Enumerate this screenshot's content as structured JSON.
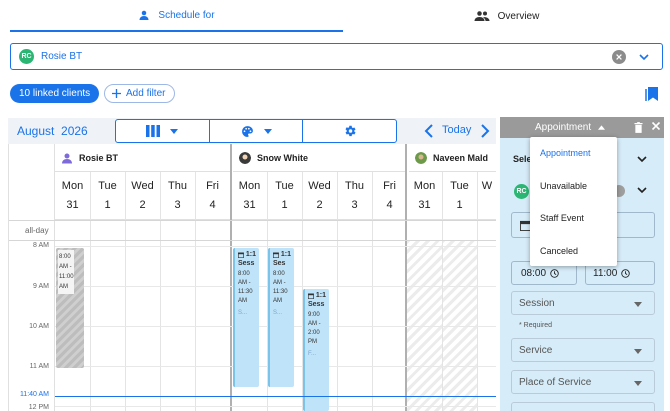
{
  "tabs": {
    "schedule_label": "Schedule for",
    "overview_label": "Overview"
  },
  "client_select": {
    "avatar": "RC",
    "name": "Rosie BT"
  },
  "chips": {
    "linked": "10 linked clients",
    "add_filter": "Add filter"
  },
  "calendar": {
    "month": "August",
    "year": "2026",
    "today_label": "Today",
    "allday_label": "all-day",
    "time_labels": [
      "8 AM",
      "9 AM",
      "10 AM",
      "11 AM",
      "11:40 AM",
      "12 PM"
    ],
    "resources": [
      "Rosie BT",
      "Snow White",
      "Naveen Mald"
    ],
    "days": [
      {
        "dow": "Mon",
        "num": "31"
      },
      {
        "dow": "Tue",
        "num": "1"
      },
      {
        "dow": "Wed",
        "num": "2"
      },
      {
        "dow": "Thu",
        "num": "3"
      },
      {
        "dow": "Fri",
        "num": "4"
      },
      {
        "dow": "Mon",
        "num": "31"
      },
      {
        "dow": "Tue",
        "num": "1"
      },
      {
        "dow": "Wed",
        "num": "2"
      },
      {
        "dow": "Thu",
        "num": "3"
      },
      {
        "dow": "Fri",
        "num": "4"
      },
      {
        "dow": "Mon",
        "num": "31"
      },
      {
        "dow": "Tue",
        "num": "1"
      },
      {
        "dow": "W",
        "num": ""
      }
    ],
    "events": {
      "grey": {
        "t1": "8:00",
        "t2": "AM -",
        "t3": "11:00",
        "t4": "AM"
      },
      "s1": {
        "title": "1:1",
        "sub": "Sess",
        "time": "8:00 AM - 11:30 AM",
        "meta": "S..."
      },
      "s2": {
        "title": "1:1",
        "sub": "Ses",
        "time": "8:00 AM - 11:30 AM",
        "meta": "S..."
      },
      "s3": {
        "title": "1:1",
        "sub": "Sess",
        "time": "9:00 AM - 2:00 PM",
        "meta": "F..."
      }
    }
  },
  "panel": {
    "type_label": "Appointment",
    "select_label": "Sele",
    "avatar": "RC",
    "start_time": "08:00",
    "end_time": "11:00",
    "fields": [
      "Session",
      "Service",
      "Place of Service"
    ],
    "required": "* Required"
  },
  "menu": {
    "items": [
      "Appointment",
      "Unavailable",
      "Staff Event",
      "Canceled"
    ]
  },
  "colors": {
    "accent": "#1a73e8",
    "avatar": "#2bb673",
    "panel_bg": "#d6ecf8",
    "event_blue": "#bfe3f8"
  }
}
